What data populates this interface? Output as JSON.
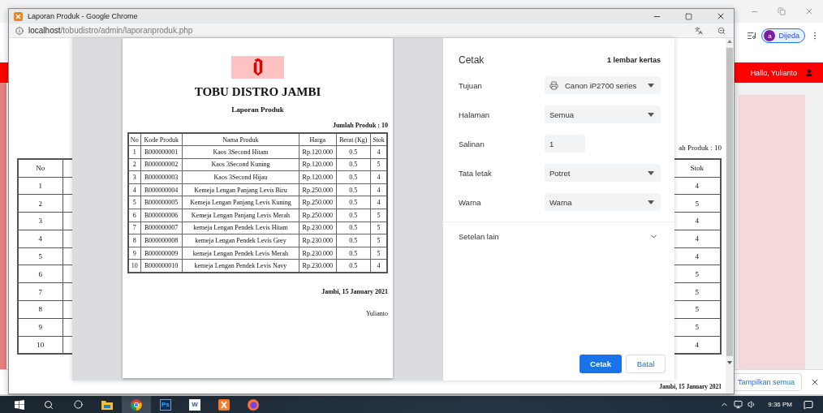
{
  "main_window": {
    "profile": {
      "initial": "a",
      "label": "Dijeda"
    },
    "greeting": "Hallo, Yulianto",
    "download_bar": {
      "show_all": "Tampilkan semua"
    }
  },
  "popup": {
    "title": "Laporan Produk - Google Chrome",
    "url": {
      "host": "localhost",
      "path": "/tobudistro/admin/laporanproduk.php"
    },
    "page": {
      "count_fragment": "ah Produk : 10",
      "table": {
        "columns": [
          "No",
          "Stok"
        ],
        "rows": [
          [
            "1",
            "4"
          ],
          [
            "2",
            "5"
          ],
          [
            "3",
            "4"
          ],
          [
            "4",
            "4"
          ],
          [
            "5",
            "4"
          ],
          [
            "6",
            "5"
          ],
          [
            "7",
            "5"
          ],
          [
            "8",
            "5"
          ],
          [
            "9",
            "5"
          ],
          [
            "10",
            "4"
          ]
        ]
      },
      "footer": "Jambi, 15 January 2021"
    }
  },
  "print_dialog": {
    "preview": {
      "company": "TOBU DISTRO JAMBI",
      "report_title": "Laporan Produk",
      "count": "Jumlah Produk : 10",
      "table": {
        "columns": [
          "No",
          "Kode Produk",
          "Nama Produk",
          "Harga",
          "Berat (Kg)",
          "Stok"
        ],
        "rows": [
          [
            "1",
            "B000000001",
            "Kaos 3Second Hitam",
            "Rp.120.000",
            "0.5",
            "4"
          ],
          [
            "2",
            "B000000002",
            "Kaos 3Second Kuning",
            "Rp.120.000",
            "0.5",
            "5"
          ],
          [
            "3",
            "B000000003",
            "Kaos 3Second Hijau",
            "Rp.120.000",
            "0.5",
            "4"
          ],
          [
            "4",
            "B000000004",
            "Kemeja Lengan Panjang Levis Biru",
            "Rp.250.000",
            "0.5",
            "4"
          ],
          [
            "5",
            "B000000005",
            "Kemeja Lengan Panjang Levis Kuning",
            "Rp.250.000",
            "0.5",
            "4"
          ],
          [
            "6",
            "B000000006",
            "Kemeja Lengan Panjang Levis Merah",
            "Rp.250.000",
            "0.5",
            "5"
          ],
          [
            "7",
            "B000000007",
            "kemeja Lengan Pendek Levis Hitam",
            "Rp.230.000",
            "0.5",
            "5"
          ],
          [
            "8",
            "B000000008",
            "kemeja Lengan Pendek Levis Grey",
            "Rp.230.000",
            "0.5",
            "5"
          ],
          [
            "9",
            "B000000009",
            "kemeja Lengan Pendek Levis Merah",
            "Rp.230.000",
            "0.5",
            "5"
          ],
          [
            "10",
            "B000000010",
            "kemeja Lengan Pendek Levis Navy",
            "Rp.230.000",
            "0.5",
            "4"
          ]
        ]
      },
      "date": "Jambi, 15 January 2021",
      "signature": "Yulianto"
    },
    "settings": {
      "title": "Cetak",
      "sheets": "1 lembar kertas",
      "fields": [
        {
          "label": "Tujuan",
          "kind": "destination",
          "value": "Canon iP2700 series"
        },
        {
          "label": "Halaman",
          "kind": "select",
          "value": "Semua"
        },
        {
          "label": "Salinan",
          "kind": "number",
          "value": "1"
        },
        {
          "label": "Tata letak",
          "kind": "select",
          "value": "Potret"
        },
        {
          "label": "Warna",
          "kind": "select",
          "value": "Warna"
        }
      ],
      "more_settings": {
        "label": "Setelan lain",
        "expanded": false
      },
      "buttons": {
        "primary": "Cetak",
        "secondary": "Batal"
      }
    }
  },
  "taskbar": {
    "ps_badge": "Ps",
    "word_badge": "W",
    "time": "9:36 PM"
  }
}
